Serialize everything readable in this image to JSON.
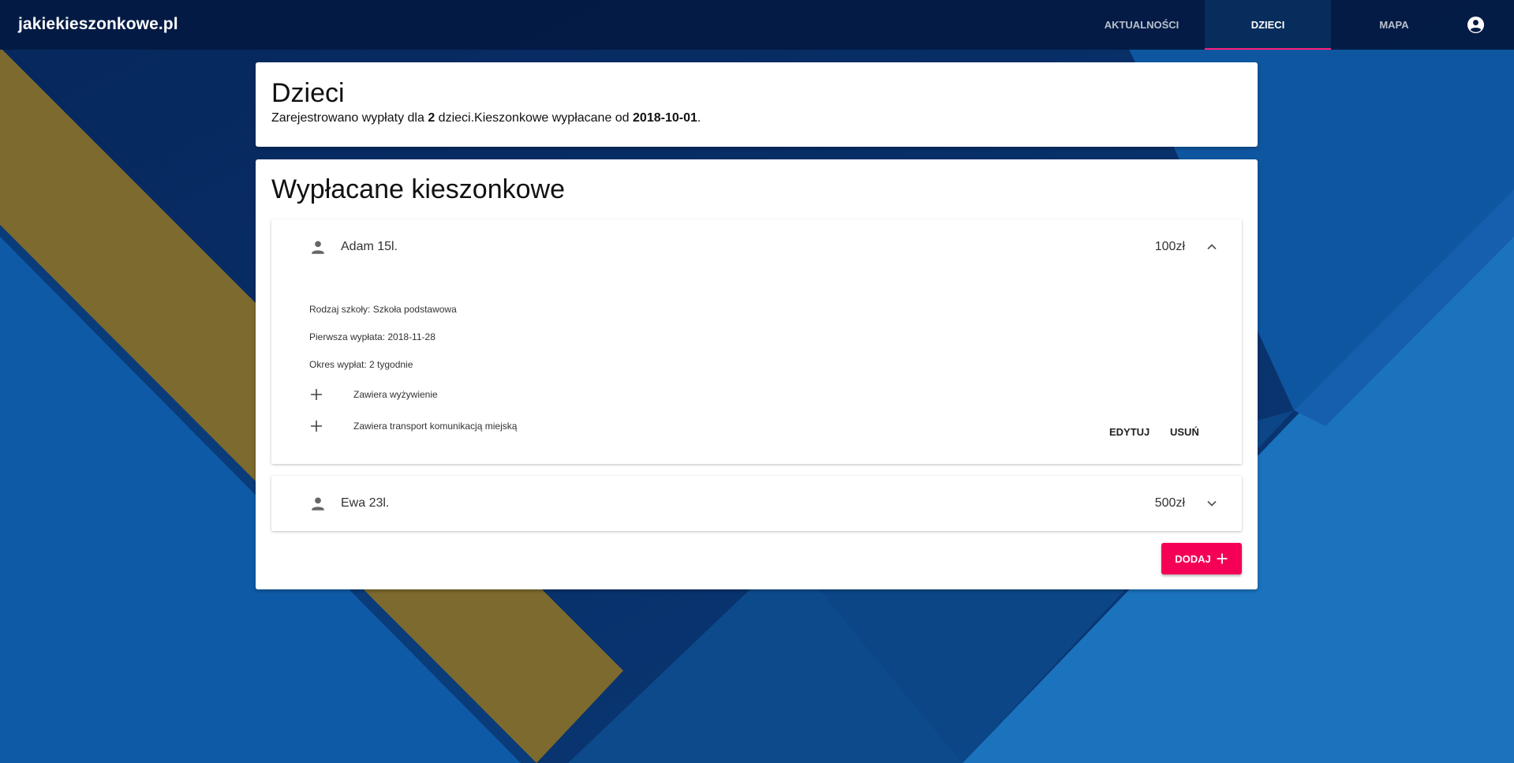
{
  "app": {
    "brand": "jakiekieszonkowe.pl"
  },
  "nav": {
    "tabs": [
      {
        "label": "AKTUALNOŚCI",
        "active": false
      },
      {
        "label": "DZIECI",
        "active": true
      },
      {
        "label": "MAPA",
        "active": false
      }
    ],
    "account_icon": "account-circle-icon"
  },
  "intro": {
    "title": "Dzieci",
    "text_before": "Zarejestrowano wypłaty dla ",
    "children_count": "2",
    "text_middle": " dzieci.Kieszonkowe wypłacane od ",
    "start_date": "2018-10-01",
    "text_after": "."
  },
  "list": {
    "title": "Wypłacane kieszonkowe",
    "children": [
      {
        "name": "Adam 15l.",
        "amount": "100zł",
        "expanded": true,
        "school": "Rodzaj szkoły: Szkoła podstawowa",
        "first_payment": "Pierwsza wypłata: 2018-11-28",
        "period": "Okres wypłat: 2 tygodnie",
        "features": [
          "Zawiera wyżywienie",
          "Zawiera transport komunikacją miejską"
        ],
        "edit_label": "EDYTUJ",
        "delete_label": "USUŃ"
      },
      {
        "name": "Ewa 23l.",
        "amount": "500zł",
        "expanded": false
      }
    ],
    "add_label": "DODAJ"
  },
  "colors": {
    "accent": "#f50057",
    "topbar": "#031a42",
    "background_blue": "#0d4a8c",
    "gold_stripe": "#7d6a2e"
  }
}
